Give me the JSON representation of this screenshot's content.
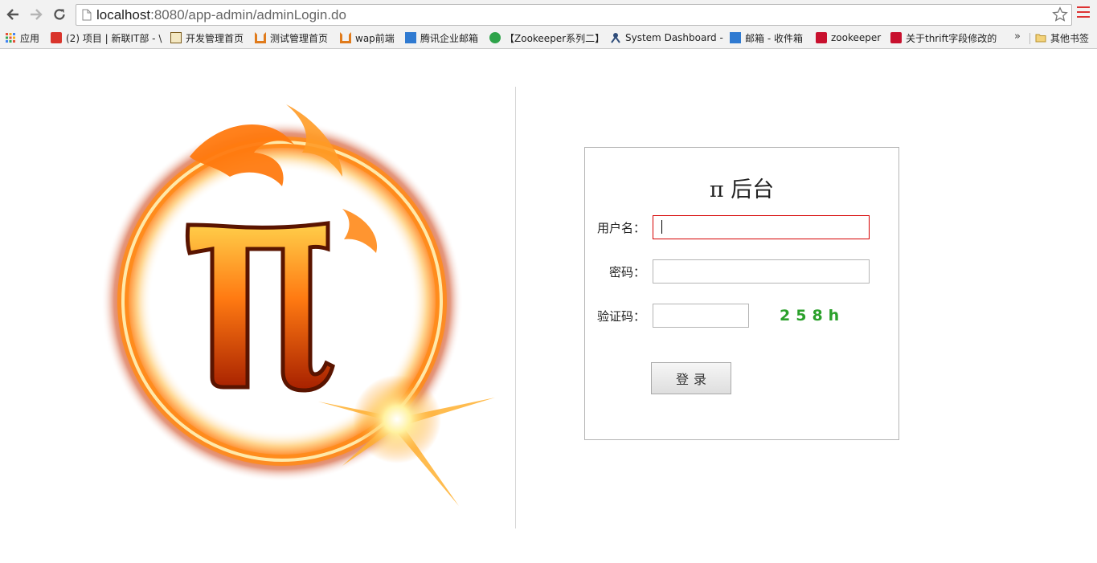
{
  "browser": {
    "url_host": "localhost",
    "url_rest": ":8080/app-admin/adminLogin.do",
    "bookmarks": [
      {
        "label": "应用",
        "color": "#e5533b"
      },
      {
        "label": "(2) 项目 | 新联IT部 - \\",
        "color": "#d9342b"
      },
      {
        "label": "开发管理首页",
        "color": "#7a5a1a"
      },
      {
        "label": "测试管理首页",
        "color": "#e07b1c"
      },
      {
        "label": "wap前端",
        "color": "#e07b1c"
      },
      {
        "label": "腾讯企业邮箱",
        "color": "#2f7ad1"
      },
      {
        "label": "【Zookeeper系列二】",
        "color": "#2ea34a"
      },
      {
        "label": "System Dashboard -",
        "color": "#2f4d7a"
      },
      {
        "label": "邮箱 - 收件箱",
        "color": "#2f7ad1"
      },
      {
        "label": "zookeeper",
        "color": "#c8102e"
      },
      {
        "label": "关于thrift字段修改的",
        "color": "#c8102e"
      }
    ],
    "more_label": "»",
    "other_bookmarks": "其他书签"
  },
  "login": {
    "title": "π 后台",
    "username_label": "用户名：",
    "username_value": "",
    "password_label": "密码：",
    "password_value": "",
    "captcha_label": "验证码：",
    "captcha_value": "",
    "captcha_text": "258h",
    "submit_label": "登录"
  }
}
